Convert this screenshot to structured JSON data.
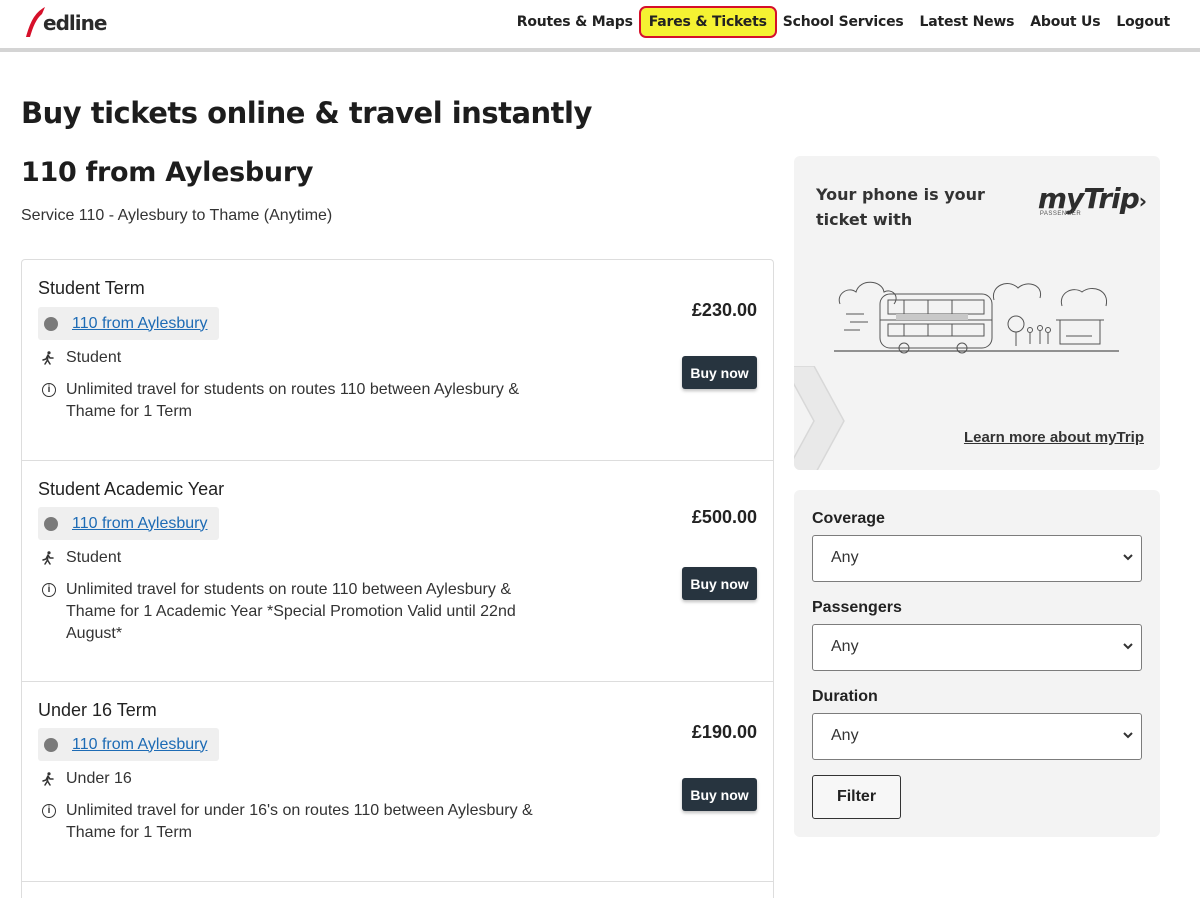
{
  "header": {
    "logo_text": "edline",
    "nav": [
      {
        "label": "Routes & Maps"
      },
      {
        "label": "Fares & Tickets"
      },
      {
        "label": "School Services"
      },
      {
        "label": "Latest News"
      },
      {
        "label": "About Us"
      },
      {
        "label": "Logout"
      }
    ]
  },
  "main": {
    "page_title": "Buy tickets online & travel instantly",
    "route_title": "110 from Aylesbury",
    "service_subtitle": "Service 110 - Aylesbury to Thame (Anytime)",
    "tickets": [
      {
        "name": "Student Term",
        "route_label": "110 from Aylesbury",
        "passenger": "Student",
        "description": "Unlimited travel for students on routes 110 between Aylesbury & Thame for 1 Term",
        "price": "£230.00",
        "button": "Buy now"
      },
      {
        "name": "Student Academic Year",
        "route_label": "110 from Aylesbury",
        "passenger": "Student",
        "description": "Unlimited travel for students on route 110 between Aylesbury & Thame for 1 Academic Year *Special Promotion Valid until 22nd August*",
        "price": "£500.00",
        "button": "Buy now"
      },
      {
        "name": "Under 16 Term",
        "route_label": "110 from Aylesbury",
        "passenger": "Under 16",
        "description": "Unlimited travel for under 16's on routes 110 between Aylesbury & Thame for 1 Term",
        "price": "£190.00",
        "button": "Buy now"
      }
    ]
  },
  "promo": {
    "text": "Your phone is your ticket with",
    "brand": "myTrip",
    "brand_by": "PASSENGER",
    "link": "Learn more about myTrip"
  },
  "filters": {
    "coverage_label": "Coverage",
    "coverage_value": "Any",
    "passengers_label": "Passengers",
    "passengers_value": "Any",
    "duration_label": "Duration",
    "duration_value": "Any",
    "filter_button": "Filter"
  },
  "icons": {
    "passenger": "walking-person-icon",
    "info": "info-circle-icon",
    "select": "chevron-down-icon"
  },
  "colors": {
    "accent_red": "#d6102a",
    "highlight_yellow": "#f5f232",
    "button_dark": "#27343f",
    "link_blue": "#1d6bb5"
  }
}
